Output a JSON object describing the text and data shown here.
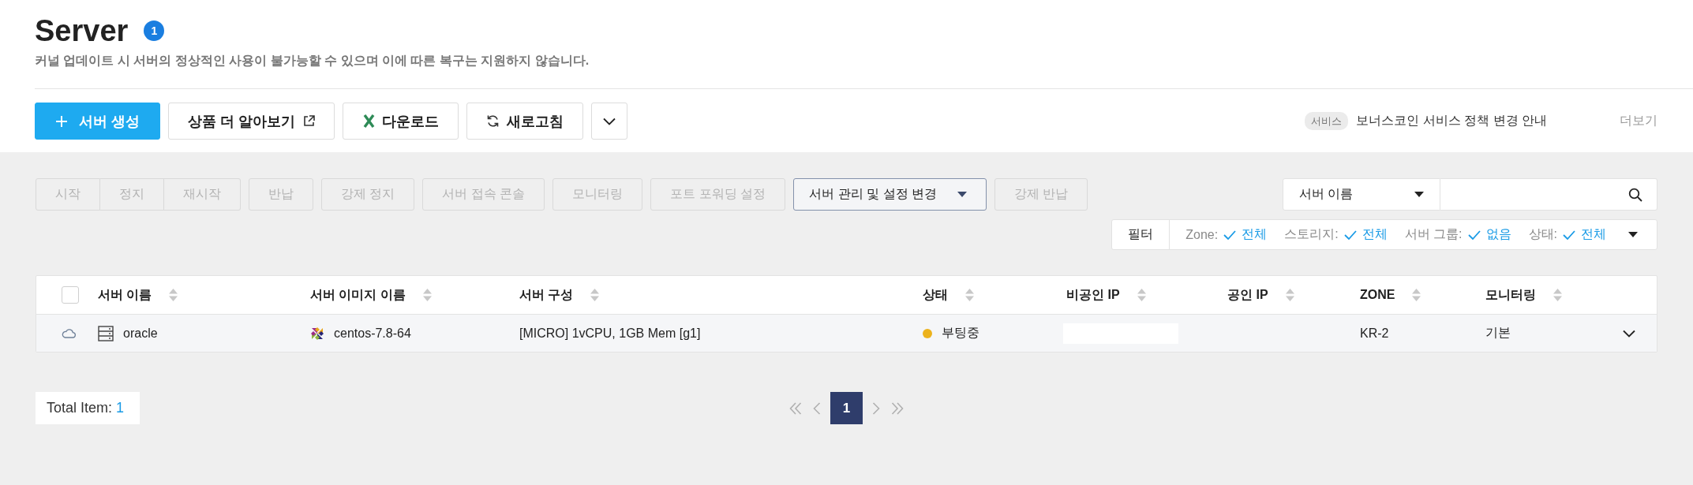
{
  "header": {
    "title": "Server",
    "count": "1",
    "notice": "커널 업데이트 시 서버의 정상적인 사용이 불가능할 수 있으며 이에 따른 복구는 지원하지 않습니다."
  },
  "toolbar": {
    "buttons": [
      {
        "kind": "primary",
        "label": "서버 생성"
      },
      {
        "kind": "external",
        "label": "상품 더 알아보기"
      },
      {
        "kind": "spreadsheet",
        "label": "다운로드"
      },
      {
        "kind": "refresh",
        "label": "새로고침"
      },
      {
        "kind": "more"
      }
    ],
    "news": {
      "tag": "서비스",
      "text": "보너스코인 서비스 정책 변경 안내",
      "more": "더보기"
    }
  },
  "action_groups": [
    {
      "buttons": [
        {
          "kind": "plain",
          "label": "시작",
          "disabled": true
        },
        {
          "kind": "plain",
          "label": "정지",
          "disabled": true
        },
        {
          "kind": "plain",
          "label": "재시작",
          "disabled": true
        }
      ]
    },
    {
      "buttons": [
        {
          "kind": "plain",
          "label": "반납",
          "disabled": true
        }
      ]
    },
    {
      "buttons": [
        {
          "kind": "plain",
          "label": "강제 정지",
          "disabled": true
        }
      ]
    },
    {
      "buttons": [
        {
          "kind": "plain",
          "label": "서버 접속 콘솔",
          "disabled": true
        }
      ]
    },
    {
      "buttons": [
        {
          "kind": "plain",
          "label": "모니터링",
          "disabled": true
        }
      ]
    },
    {
      "buttons": [
        {
          "kind": "plain",
          "label": "포트 포워딩 설정",
          "disabled": true
        }
      ]
    },
    {
      "buttons": [
        {
          "kind": "dropdown",
          "label": "서버 관리 및 설정 변경",
          "disabled": false
        }
      ]
    },
    {
      "buttons": [
        {
          "kind": "plain",
          "label": "강제 반납",
          "disabled": true
        }
      ]
    }
  ],
  "search": {
    "field": "서버 이름"
  },
  "filter": {
    "label": "필터",
    "items": [
      {
        "name": "Zone:",
        "value": "전체"
      },
      {
        "name": "스토리지:",
        "value": "전체"
      },
      {
        "name": "서버 그룹:",
        "value": "없음"
      },
      {
        "name": "상태:",
        "value": "전체"
      }
    ]
  },
  "table": {
    "select_all_checked": false,
    "columns": [
      "서버 이름",
      "서버 이미지 이름",
      "서버 구성",
      "상태",
      "비공인 IP",
      "공인 IP",
      "ZONE",
      "모니터링"
    ],
    "rows": [
      {
        "name": "oracle",
        "image": "centos-7.8-64",
        "spec": "[MICRO] 1vCPU, 1GB Mem [g1]",
        "status": {
          "label": "부팅중",
          "color": "#ecb21c"
        },
        "private_ip_redacted": true,
        "zone": "KR-2",
        "monitoring": "기본",
        "expanded": false
      }
    ]
  },
  "pagination": {
    "total_label": "Total Item:",
    "total": "1",
    "pages": [
      {
        "label": "1",
        "selected": true
      }
    ]
  }
}
